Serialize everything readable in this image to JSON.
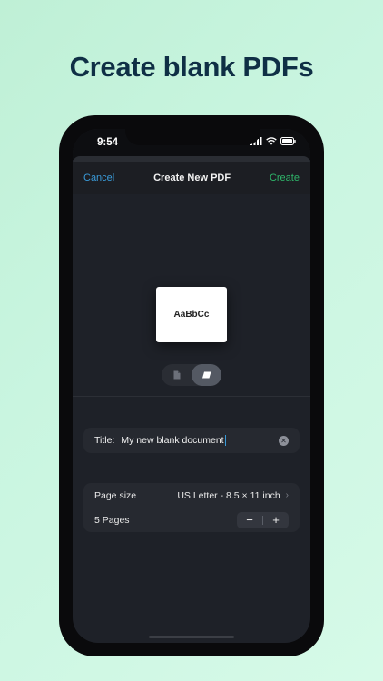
{
  "headline": "Create blank PDFs",
  "status_bar": {
    "time": "9:54"
  },
  "navbar": {
    "cancel": "Cancel",
    "title": "Create New PDF",
    "create": "Create"
  },
  "preview": {
    "sample_text": "AaBbCc"
  },
  "segmented_control": {
    "options": [
      "document-icon",
      "page-icon"
    ],
    "selected_index": 1
  },
  "title_field": {
    "label": "Title:",
    "value": "My new blank document"
  },
  "settings": {
    "page_size_label": "Page size",
    "page_size_value": "US Letter - 8.5 × 11 inch",
    "pages_label": "5 Pages",
    "pages_count": 5,
    "decrement": "−",
    "increment": "+"
  },
  "colors": {
    "background": "#c9f5e0",
    "headline": "#0f2f45",
    "screen": "#1e2128",
    "accent_blue": "#3a9bd9",
    "accent_green": "#2fb56a"
  }
}
